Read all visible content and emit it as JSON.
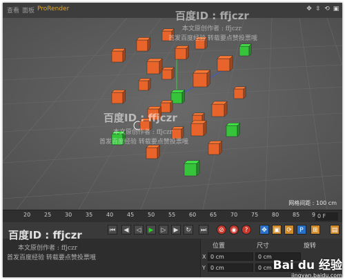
{
  "menu": {
    "item1": "查看",
    "item2": "面板",
    "item3": "ProRender"
  },
  "nav_icons": [
    "move-view-icon",
    "zoom-view-icon",
    "rotate-view-icon",
    "toggle-view-icon"
  ],
  "viewport": {
    "grid_label": "网格间距 : 100 cm"
  },
  "timeline": {
    "ticks": [
      "20",
      "25",
      "30",
      "35",
      "40",
      "45",
      "50",
      "55",
      "60",
      "65",
      "70",
      "75",
      "80",
      "85",
      "90"
    ],
    "frame_value": "0 F"
  },
  "attributes": {
    "position_header": "位置",
    "size_header": "尺寸",
    "rotation_header": "旋转",
    "rows": [
      {
        "axis": "X",
        "pos": "0 cm",
        "size": "0 cm"
      },
      {
        "axis": "Y",
        "pos": "0 cm",
        "size": "0 cm"
      }
    ]
  },
  "watermark": {
    "id": "百度ID : ffjczr",
    "line1": "本文原创作者 : ffjczr",
    "line2": "首发百度经验  转载要点赞投票哦"
  },
  "baidu": {
    "brand": "Bai du 经验",
    "url": "jingyan.baidu.com"
  },
  "colors": {
    "orange_cube": "#e8642a",
    "green_cube": "#35c43a",
    "viewport_bg": "#5a5a5a"
  }
}
